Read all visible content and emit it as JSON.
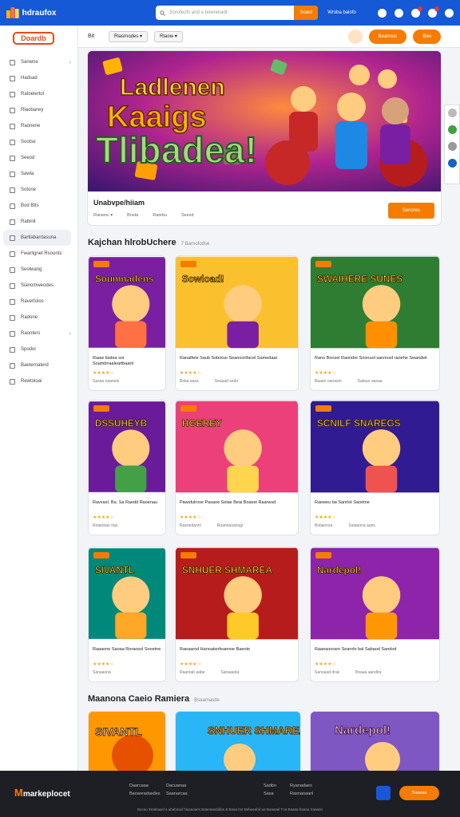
{
  "topbar": {
    "brand": "hdraufox",
    "search_placeholder": "Sorofecfn and a bowrenadt",
    "search_button": "Soaol",
    "link": "Wroba balofo",
    "icons": [
      "globe-icon",
      "help-icon",
      "bell-icon",
      "cart-icon",
      "user-icon"
    ],
    "accent": "#1559d6"
  },
  "sidebar": {
    "logo": "Doardb",
    "items": [
      {
        "label": "Sanwne",
        "chev": "›"
      },
      {
        "label": "Hadsad"
      },
      {
        "label": "Ratoelertol"
      },
      {
        "label": "Rlaobarwy"
      },
      {
        "label": "Raonene"
      },
      {
        "label": "Sootse"
      },
      {
        "label": "Seeod"
      },
      {
        "label": "Sawla"
      },
      {
        "label": "Sotone"
      },
      {
        "label": "Bod Btts"
      },
      {
        "label": "Rabinit"
      },
      {
        "label": "Bartlabarrtasuna",
        "active": true
      },
      {
        "label": "Fwarilgnet Rsoonts"
      },
      {
        "label": "Seolwang"
      },
      {
        "label": "Sianomweodes"
      },
      {
        "label": "Ravertolos"
      },
      {
        "label": "Radone"
      },
      {
        "label": "Raonters",
        "chev": "›"
      },
      {
        "label": "Spodoi"
      },
      {
        "label": "Baeternaterd"
      },
      {
        "label": "Rewtoloai"
      }
    ]
  },
  "subbar": {
    "breadcrumb": "Bit",
    "chip1": "Rlasrnodes ▾",
    "chip2": "Rtaow ▾",
    "pill1": "Beannos",
    "pill2": "Bao"
  },
  "hero": {
    "title": "Unabvpe/hiiam",
    "meta": [
      "Ranwoc ▾",
      "Bnsta",
      "Ratebu",
      "Seesd"
    ],
    "button": "Senores",
    "banner_text_1": "Ladlenen",
    "banner_text_2": "Kaaigs",
    "banner_text_3": "Tlibadea!"
  },
  "section1": {
    "title": "Kajchan hlrobUchere",
    "sub": "7 Barnofodse"
  },
  "section2": {
    "title": "Maanona Caeio Ramiera",
    "sub": "Bsaamasde"
  },
  "cards": [
    {
      "title": "Raaw bsdea sor Soambnaaleartbaant",
      "stars": "★★★★☆",
      "price": "Sasaa naaniok",
      "price2": ""
    },
    {
      "title": "Ranatfele Saub Sobotuo Seanoortfacel Samedaat",
      "stars": "★★★★☆",
      "price": "Bsba aasa",
      "price2": "Seaaad sedo"
    },
    {
      "title": "Rano Bonsel Raondre Snonuol sannosd raoehe Swandwt",
      "stars": "★★★★☆",
      "price": "Baaeo oanasm",
      "price2": "Sataao aasaa"
    },
    {
      "title": "Ravvael. Ba. Sa Raedd Raoenau",
      "stars": "★★★★☆",
      "price": "Rotanbao rtas",
      "price2": ""
    },
    {
      "title": "Pawsfulrose Pasaoe Selae Beai Boaest Raarwsd",
      "stars": "★★★★☆",
      "price": "Rasnedannl",
      "price2": "Raannaoansgi"
    },
    {
      "title": "Raeweu ba Sanrlot Saoetne",
      "stars": "★★★★☆",
      "price": "Bsbannsa",
      "price2": "Sutaaona aans"
    },
    {
      "title": "Raaaone Saoaa Roraosol Sooetne",
      "stars": "★★★★☆",
      "price": "Sanaaona",
      "price2": ""
    },
    {
      "title": "Raeaarod Hanoatsnfeaenoe Baeote",
      "stars": "★★★★☆",
      "price": "Raaotab aabe",
      "price2": "Sanaaeda"
    },
    {
      "title": "Raaeaoorare Seanrle bal Sabaod Sandod",
      "stars": "★★★★☆",
      "price": "Sanoaad dras",
      "price2": "Bxaaa aandlra"
    }
  ],
  "card_labels": [
    "Soumnadens",
    "Sowload!",
    "SWAIHERE SUNES",
    "DSSUHEYB",
    "HGEREY",
    "SCNILF SNAREGS",
    "SIVANTL",
    "SNHUER SHMAREA",
    "Nardepol!"
  ],
  "footer": {
    "logo_m": "M",
    "logo": "markeplocet",
    "col1": [
      "Daarcaaa",
      "Baoareadasdes"
    ],
    "col2": [
      "Dacuanaa",
      "Saanarcaa"
    ],
    "col3": [
      "Sadbn",
      "Sasa"
    ],
    "col4": [
      "Ryanadaes",
      "Rasnaoaanl"
    ],
    "button": "Saoeae",
    "copyright": "Bocao Sealnaasl a ababaasl hloaaoaes Baaeaasdafas & Baaa bot Bebaeabd aa Boaaaal Tna Baaaa baaaa Saaado"
  }
}
